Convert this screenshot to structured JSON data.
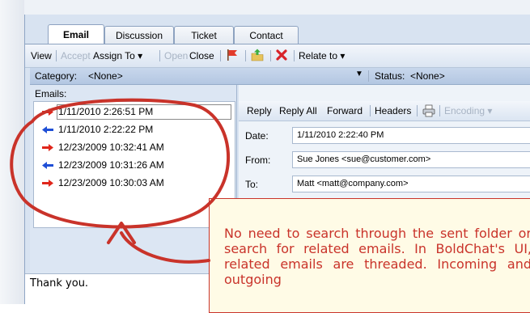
{
  "tabs": [
    {
      "label": "Email",
      "active": true
    },
    {
      "label": "Discussion",
      "active": false
    },
    {
      "label": "Ticket",
      "active": false
    },
    {
      "label": "Contact",
      "active": false
    }
  ],
  "toolbar": {
    "view": "View",
    "accept": "Accept",
    "assign_to": "Assign To",
    "open": "Open",
    "close": "Close",
    "relate_to": "Relate to"
  },
  "category_bar": {
    "category_label": "Category:",
    "category_value": "<None>",
    "status_label": "Status:",
    "status_value": "<None>"
  },
  "emails": {
    "label": "Emails:",
    "items": [
      {
        "date": "1/11/2010 2:26:51 PM",
        "direction": "outgoing",
        "selected": true
      },
      {
        "date": "1/11/2010 2:22:22 PM",
        "direction": "incoming",
        "selected": false
      },
      {
        "date": "12/23/2009 10:32:41 AM",
        "direction": "outgoing",
        "selected": false
      },
      {
        "date": "12/23/2009 10:31:26 AM",
        "direction": "incoming",
        "selected": false
      },
      {
        "date": "12/23/2009 10:30:03 AM",
        "direction": "outgoing",
        "selected": false
      }
    ]
  },
  "message_toolbar": {
    "reply": "Reply",
    "reply_all": "Reply All",
    "forward": "Forward",
    "headers": "Headers",
    "encoding": "Encoding"
  },
  "message": {
    "date_label": "Date:",
    "date_value": "1/11/2010 2:22:40 PM",
    "from_label": "From:",
    "from_value": "Sue Jones <sue@customer.com>",
    "to_label": "To:",
    "to_value": "Matt <matt@company.com>",
    "body_preview": "Thank you."
  },
  "callout": {
    "text": "No need to search through the sent folder or search for related emails. In BoldChat's UI, related emails are threaded. Incoming and outgoing"
  },
  "colors": {
    "outgoing_arrow": "#e0261b",
    "incoming_arrow": "#1f4fd6",
    "annotation": "#c9332a"
  }
}
